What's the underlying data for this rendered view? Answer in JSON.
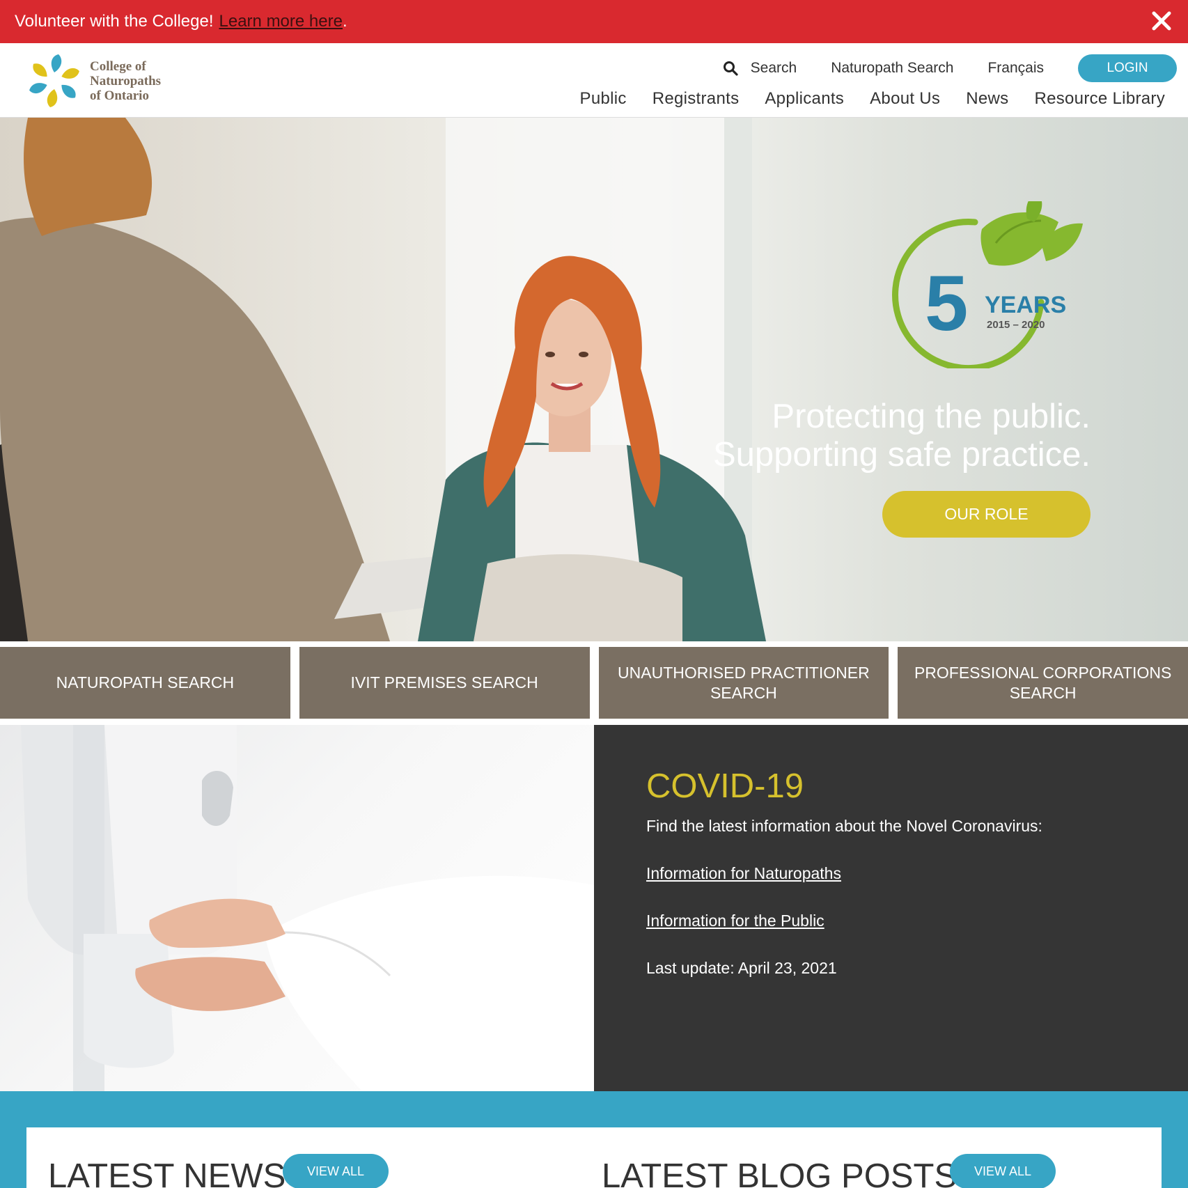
{
  "alert": {
    "text": "Volunteer with the College!",
    "link": "Learn more here",
    "suffix": ".",
    "close_icon": "close-icon"
  },
  "header": {
    "logo_lines": [
      "College of",
      "Naturopaths",
      "of Ontario"
    ],
    "utility": {
      "search": "Search",
      "naturopath_search": "Naturopath Search",
      "language": "Français",
      "login": "LOGIN"
    },
    "nav": [
      "Public",
      "Registrants",
      "Applicants",
      "About Us",
      "News",
      "Resource Library"
    ]
  },
  "hero": {
    "badge_number": "5",
    "badge_years": "YEARS",
    "badge_range": "2015 – 2020",
    "tagline_line1": "Protecting the public.",
    "tagline_line2": "Supporting safe practice.",
    "button": "OUR ROLE"
  },
  "tiles": [
    "NATUROPATH SEARCH",
    "IVIT PREMISES SEARCH",
    "UNAUTHORISED PRACTITIONER SEARCH",
    "PROFESSIONAL CORPORATIONS SEARCH"
  ],
  "covid": {
    "title": "COVID-19",
    "intro": "Find the latest information about the Novel Coronavirus:",
    "link_naturopaths": "Information for Naturopaths",
    "link_public": "Information for the Public",
    "update": "Last update: April 23, 2021"
  },
  "bottom": {
    "news_heading": "LATEST NEWS",
    "news_button": "VIEW ALL",
    "blog_heading": "LATEST BLOG POSTS",
    "blog_button": "VIEW ALL"
  },
  "colors": {
    "alert": "#d9292f",
    "accent_blue": "#37a5c5",
    "accent_gold": "#d6c12d",
    "tile_brown": "#7a6f62",
    "covid_bg": "#353535"
  }
}
